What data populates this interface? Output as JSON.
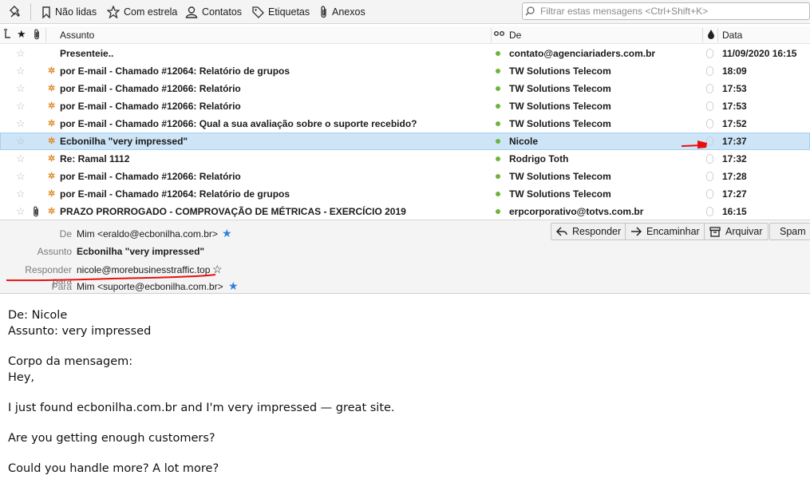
{
  "toolbar": {
    "unread": "Não lidas",
    "starred": "Com estrela",
    "contacts": "Contatos",
    "tags": "Etiquetas",
    "attachments": "Anexos",
    "search_placeholder": "Filtrar estas mensagens <Ctrl+Shift+K>"
  },
  "columns": {
    "subject": "Assunto",
    "from": "De",
    "date": "Data"
  },
  "messages": [
    {
      "subject": "Presenteie..",
      "from": "contato@agenciariaders.com.br",
      "date": "11/09/2020 16:15",
      "thread": false,
      "attach": false
    },
    {
      "subject": "por E-mail - Chamado #12064: Relatório de grupos",
      "from": "TW Solutions Telecom",
      "date": "18:09",
      "thread": true,
      "attach": false
    },
    {
      "subject": "por E-mail - Chamado #12066: Relatório",
      "from": "TW Solutions Telecom",
      "date": "17:53",
      "thread": true,
      "attach": false
    },
    {
      "subject": "por E-mail - Chamado #12066: Relatório",
      "from": "TW Solutions Telecom",
      "date": "17:53",
      "thread": true,
      "attach": false
    },
    {
      "subject": "por E-mail - Chamado #12066: Qual a sua avaliação sobre o suporte recebido?",
      "from": "TW Solutions Telecom",
      "date": "17:52",
      "thread": true,
      "attach": false
    },
    {
      "subject": "Ecbonilha \"very impressed\"",
      "from": "Nicole",
      "date": "17:37",
      "thread": true,
      "attach": false,
      "selected": true
    },
    {
      "subject": "Re: Ramal 1112",
      "from": "Rodrigo Toth",
      "date": "17:32",
      "thread": true,
      "attach": false
    },
    {
      "subject": "por E-mail - Chamado #12066: Relatório",
      "from": "TW Solutions Telecom",
      "date": "17:28",
      "thread": true,
      "attach": false
    },
    {
      "subject": "por E-mail - Chamado #12064: Relatório de grupos",
      "from": "TW Solutions Telecom",
      "date": "17:27",
      "thread": true,
      "attach": false
    },
    {
      "subject": "PRAZO PRORROGADO - COMPROVAÇÃO DE MÉTRICAS - EXERCÍCIO 2019",
      "from": "erpcorporativo@totvs.com.br",
      "date": "16:15",
      "thread": true,
      "attach": true
    }
  ],
  "header": {
    "from_label": "De",
    "from_value": "Mim <eraldo@ecbonilha.com.br>",
    "subject_label": "Assunto",
    "subject_value": "Ecbonilha \"very impressed\"",
    "replyto_label": "Responder para",
    "replyto_value": "nicole@morebusinesstraffic.top",
    "to_label": "Para",
    "to_value": "Mim <suporte@ecbonilha.com.br>",
    "reply_button": "Responder",
    "forward_button": "Encaminhar",
    "archive_button": "Arquivar",
    "spam_button": "Spam"
  },
  "body": {
    "line1": "De: Nicole",
    "line2": "Assunto: very impressed",
    "line3": "Corpo da mensagem:",
    "line4": "Hey,",
    "line5": "I just found ecbonilha.com.br and I'm very impressed — great site.",
    "line6": "Are you getting enough customers?",
    "line7": "Could you handle more? A lot more?"
  },
  "colors": {
    "selection": "#cde5f7",
    "online_dot": "#6fb43a",
    "thread_star": "#e08a2a",
    "annotation": "#e8100c",
    "blue_star": "#2f7fe0"
  }
}
